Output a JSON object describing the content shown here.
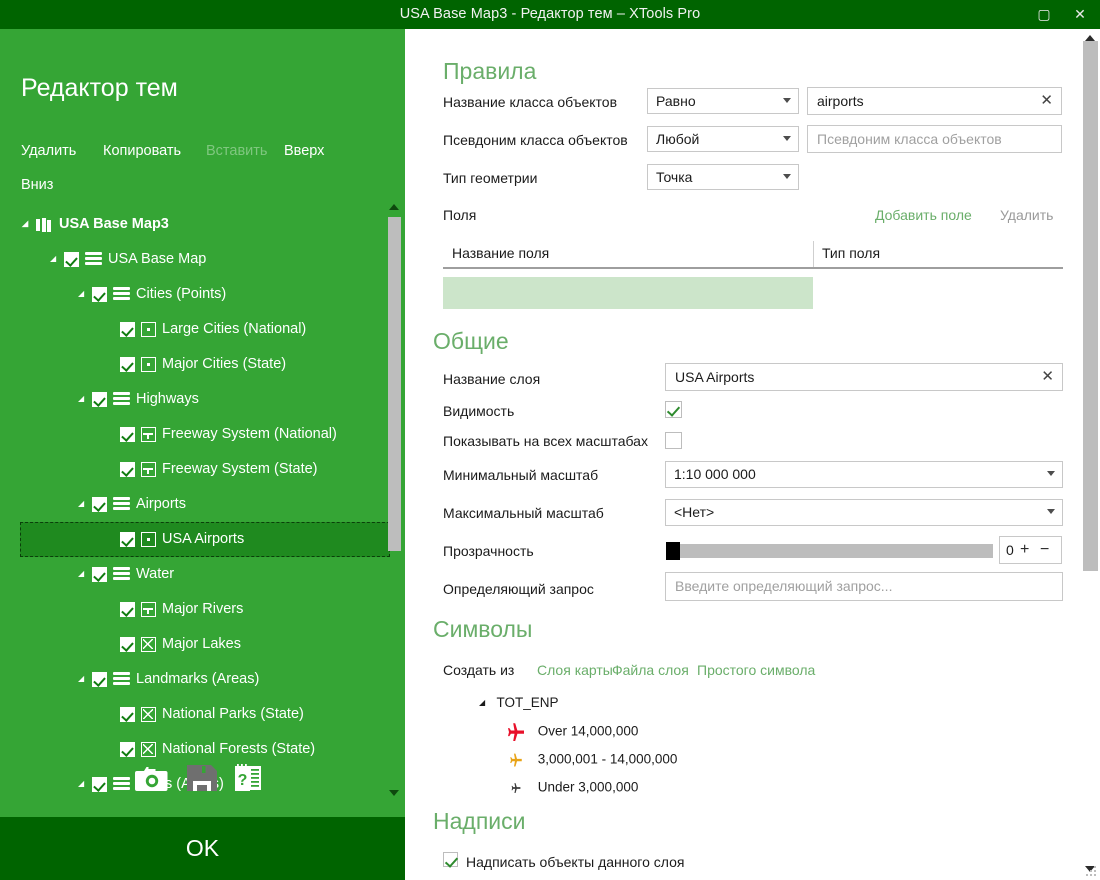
{
  "window": {
    "title": "USA Base Map3 - Редактор тем – XTools Pro",
    "maximize_icon": "maximize-icon",
    "close_icon": "close-icon",
    "maximize_glyph": "▢",
    "close_glyph": "✕"
  },
  "left_panel": {
    "heading": "Редактор тем",
    "commands": [
      {
        "label": "Удалить",
        "disabled": false
      },
      {
        "label": "Копировать",
        "disabled": false
      },
      {
        "label": "Вставить",
        "disabled": true
      },
      {
        "label": "Вверх",
        "disabled": false
      },
      {
        "label": "Вниз",
        "disabled": false
      }
    ],
    "tree": [
      {
        "label": "USA Base Map3",
        "indent": 0,
        "icon": "map-icon",
        "checkbox": false,
        "expander": true,
        "selected": false,
        "root": true
      },
      {
        "label": "USA Base Map",
        "indent": 1,
        "icon": "layer-stack-icon",
        "checkbox": true,
        "expander": true,
        "selected": false,
        "root": false
      },
      {
        "label": "Cities (Points)",
        "indent": 2,
        "icon": "layer-stack-icon",
        "checkbox": true,
        "expander": true,
        "selected": false,
        "root": false
      },
      {
        "label": "Large Cities (National)",
        "indent": 3,
        "icon": "point-feature-icon",
        "checkbox": true,
        "expander": false,
        "selected": false,
        "root": false
      },
      {
        "label": "Major Cities (State)",
        "indent": 3,
        "icon": "point-feature-icon",
        "checkbox": true,
        "expander": false,
        "selected": false,
        "root": false
      },
      {
        "label": "Highways",
        "indent": 2,
        "icon": "layer-stack-icon",
        "checkbox": true,
        "expander": true,
        "selected": false,
        "root": false
      },
      {
        "label": "Freeway System (National)",
        "indent": 3,
        "icon": "line-feature-icon",
        "checkbox": true,
        "expander": false,
        "selected": false,
        "root": false
      },
      {
        "label": "Freeway System (State)",
        "indent": 3,
        "icon": "line-feature-icon",
        "checkbox": true,
        "expander": false,
        "selected": false,
        "root": false
      },
      {
        "label": "Airports",
        "indent": 2,
        "icon": "layer-stack-icon",
        "checkbox": true,
        "expander": true,
        "selected": false,
        "root": false
      },
      {
        "label": "USA Airports",
        "indent": 3,
        "icon": "point-feature-icon",
        "checkbox": true,
        "expander": false,
        "selected": true,
        "root": false
      },
      {
        "label": "Water",
        "indent": 2,
        "icon": "layer-stack-icon",
        "checkbox": true,
        "expander": true,
        "selected": false,
        "root": false
      },
      {
        "label": "Major Rivers",
        "indent": 3,
        "icon": "line-feature-icon",
        "checkbox": true,
        "expander": false,
        "selected": false,
        "root": false
      },
      {
        "label": "Major Lakes",
        "indent": 3,
        "icon": "polygon-feature-icon",
        "checkbox": true,
        "expander": false,
        "selected": false,
        "root": false
      },
      {
        "label": "Landmarks (Areas)",
        "indent": 2,
        "icon": "layer-stack-icon",
        "checkbox": true,
        "expander": true,
        "selected": false,
        "root": false
      },
      {
        "label": "National Parks (State)",
        "indent": 3,
        "icon": "polygon-feature-icon",
        "checkbox": true,
        "expander": false,
        "selected": false,
        "root": false
      },
      {
        "label": "National Forests (State)",
        "indent": 3,
        "icon": "polygon-feature-icon",
        "checkbox": true,
        "expander": false,
        "selected": false,
        "root": false
      },
      {
        "label": "Cities (Areas)",
        "indent": 2,
        "icon": "layer-stack-icon",
        "checkbox": true,
        "expander": true,
        "selected": false,
        "root": false
      }
    ],
    "footer_icons": [
      {
        "name": "camera-icon"
      },
      {
        "name": "save-icon"
      },
      {
        "name": "help-icon"
      }
    ],
    "ok_label": "OK"
  },
  "rules": {
    "heading": "Правила",
    "feature_class_name_label": "Название класса объектов",
    "feature_class_name_operator": "Равно",
    "feature_class_name_value": "airports",
    "feature_class_alias_label": "Псевдоним класса объектов",
    "feature_class_alias_operator": "Любой",
    "feature_class_alias_placeholder": "Псевдоним класса объектов",
    "feature_class_alias_value": "",
    "geometry_type_label": "Тип геометрии",
    "geometry_type_value": "Точка",
    "fields_label": "Поля",
    "add_field_link": "Добавить поле",
    "delete_link": "Удалить",
    "fields_table": {
      "columns": [
        "Название поля",
        "Тип поля"
      ],
      "rows": [
        {
          "name": "",
          "type": ""
        }
      ]
    }
  },
  "general": {
    "heading": "Общие",
    "layer_name_label": "Название слоя",
    "layer_name_value": "USA Airports",
    "visibility_label": "Видимость",
    "visibility_checked": true,
    "show_all_scales_label": "Показывать на всех масштабах",
    "show_all_scales_checked": false,
    "min_scale_label": "Минимальный масштаб",
    "min_scale_value": "1:10 000 000",
    "max_scale_label": "Максимальный масштаб",
    "max_scale_value": "<Нет>",
    "transparency_label": "Прозрачность",
    "transparency_value": "0",
    "transparency_percent": 0,
    "plus_glyph": "+",
    "minus_glyph": "−",
    "definition_query_label": "Определяющий запрос",
    "definition_query_placeholder": "Введите определяющий запрос...",
    "definition_query_value": ""
  },
  "symbols": {
    "heading": "Символы",
    "create_from_label": "Создать из",
    "create_from_links": [
      "Слоя карты",
      "Файла слоя",
      "Простого символа"
    ],
    "renderer_field": "TOT_ENP",
    "classes": [
      {
        "label": "Over 14,000,000",
        "color": "#e8102a",
        "size": 18
      },
      {
        "label": "3,000,001 - 14,000,000",
        "color": "#e8a317",
        "size": 13
      },
      {
        "label": "Under 3,000,000",
        "color": "#3c3c3c",
        "size": 10
      }
    ]
  },
  "labels": {
    "heading": "Надписи",
    "label_features_text": "Надписать объекты данного слоя",
    "label_features_checked": true
  },
  "colors": {
    "panel_green": "#35a535",
    "dark_green": "#006400",
    "selection_green": "#1f8a1f",
    "section_heading_green": "#6aae6a",
    "field_row_green": "#cce5ca"
  }
}
